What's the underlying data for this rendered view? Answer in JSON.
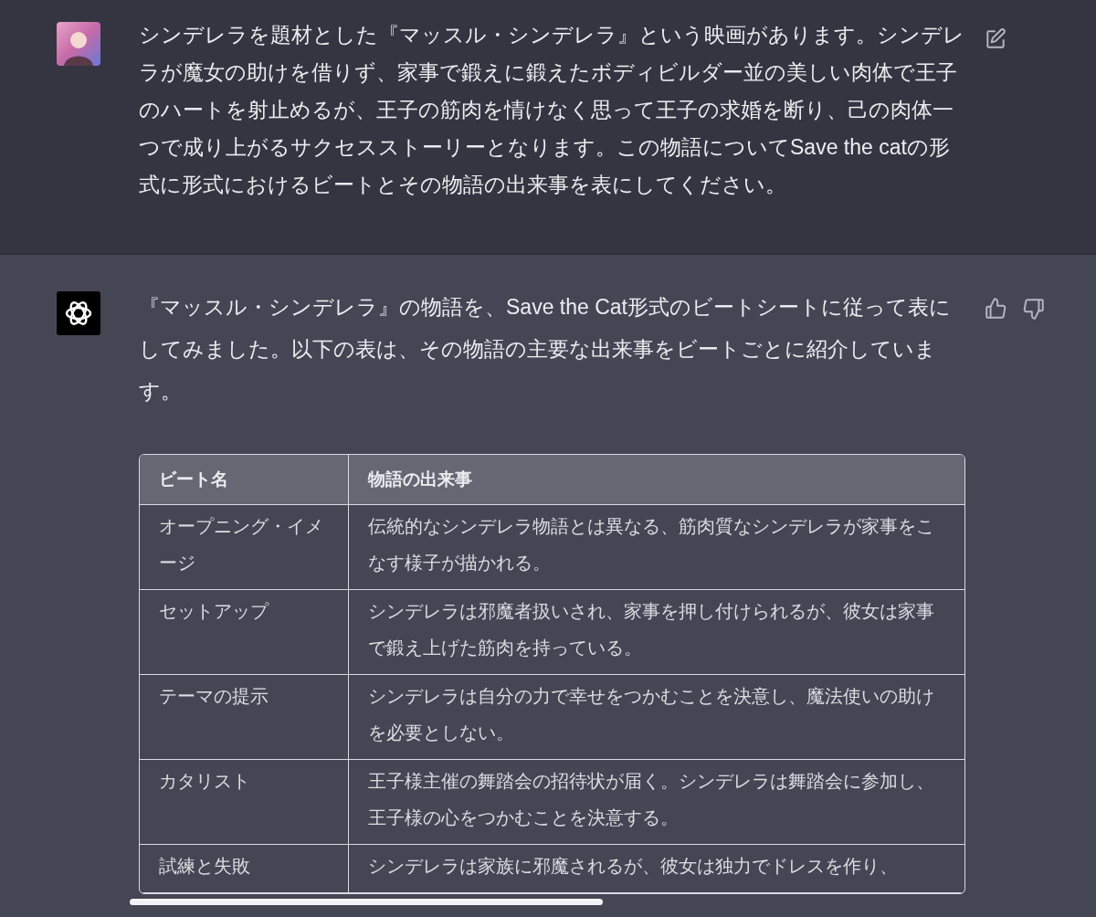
{
  "messages": [
    {
      "kind": "user",
      "text": "シンデレラを題材とした『マッスル・シンデレラ』という映画があります。シンデレラが魔女の助けを借りず、家事で鍛えに鍛えたボディビルダー並の美しい肉体で王子のハートを射止めるが、王子の筋肉を情けなく思って王子の求婚を断り、己の肉体一つで成り上がるサクセスストーリーとなります。この物語についてSave the catの形式に形式におけるビートとその物語の出来事を表にしてください。"
    },
    {
      "kind": "assistant",
      "text": "『マッスル・シンデレラ』の物語を、Save the Cat形式のビートシートに従って表にしてみました。以下の表は、その物語の主要な出来事をビートごとに紹介しています。",
      "table": {
        "columns": [
          "ビート名",
          "物語の出来事"
        ],
        "rows": [
          [
            "オープニング・イメージ",
            "伝統的なシンデレラ物語とは異なる、筋肉質なシンデレラが家事をこなす様子が描かれる。"
          ],
          [
            "セットアップ",
            "シンデレラは邪魔者扱いされ、家事を押し付けられるが、彼女は家事で鍛え上げた筋肉を持っている。"
          ],
          [
            "テーマの提示",
            "シンデレラは自分の力で幸せをつかむことを決意し、魔法使いの助けを必要としない。"
          ],
          [
            "カタリスト",
            "王子様主催の舞踏会の招待状が届く。シンデレラは舞踏会に参加し、王子様の心をつかむことを決意する。"
          ],
          [
            "試練と失敗",
            "シンデレラは家族に邪魔されるが、彼女は独力でドレスを作り、"
          ]
        ]
      }
    }
  ]
}
